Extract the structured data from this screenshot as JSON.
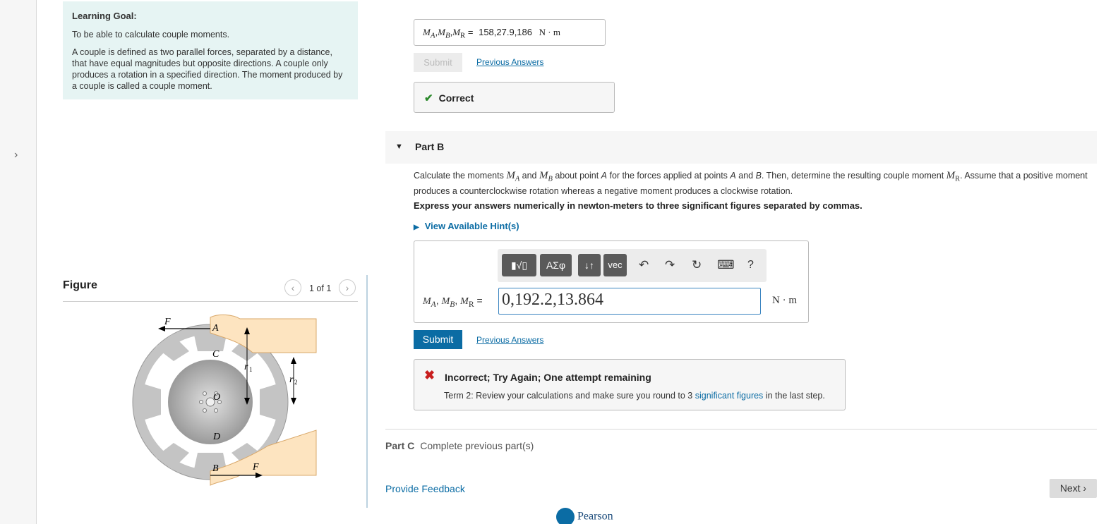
{
  "left": {
    "goal_title": "Learning Goal:",
    "goal_line1": "To be able to calculate couple moments.",
    "goal_line2": "A couple is defined as two parallel forces, separated by a distance, that have equal magnitudes but opposite directions. A couple only produces a rotation in a specified direction. The moment produced by a couple is called a couple moment.",
    "figure_title": "Figure",
    "pager_text": "1 of 1",
    "figure_labels": {
      "F_top": "F",
      "A": "A",
      "C": "C",
      "r1": "r",
      "r1_sub": "1",
      "r2": "r",
      "r2_sub": "2",
      "O": "O",
      "D": "D",
      "B": "B",
      "F_bottom": "F"
    }
  },
  "part_a": {
    "label_ma": "M",
    "sub_a": "A",
    "label_mb": "M",
    "sub_b": "B",
    "label_mr": "M",
    "sub_r": "R",
    "answer": "158,27.9,186",
    "unit": "N · m",
    "submit_label": "Submit",
    "previous_answers": "Previous Answers",
    "correct_label": "Correct"
  },
  "part_b": {
    "title": "Part B",
    "prompt_1": "Calculate the moments ",
    "prompt_2": " and ",
    "prompt_3": " about point ",
    "prompt_4": " for the forces applied at points ",
    "prompt_5": " and ",
    "prompt_6": ". Then, determine the resulting couple moment ",
    "prompt_7": ". Assume that a positive moment produces a counterclockwise rotation whereas a negative moment produces a clockwise rotation.",
    "pt_A": "A",
    "pt_B": "B",
    "express": "Express your answers numerically in newton-meters to three significant figures separated by commas.",
    "hint": "View Available Hint(s)",
    "toolbar": {
      "templates": "▮√▯",
      "greek": "ΑΣφ",
      "arrows": "↓↑",
      "vec": "vec",
      "undo": "↶",
      "redo": "↷",
      "reset": "↻",
      "keyboard": "⌨",
      "help": "?"
    },
    "input_value": "0,192.2,13.864",
    "unit": "N · m",
    "submit_label": "Submit",
    "previous_answers": "Previous Answers",
    "incorrect_title": "Incorrect; Try Again; One attempt remaining",
    "incorrect_msg_1": "Term 2: Review your calculations and make sure you round to 3 ",
    "incorrect_link": "significant figures",
    "incorrect_msg_2": " in the last step."
  },
  "part_c": {
    "label": "Part C",
    "text": "Complete previous part(s)"
  },
  "footer": {
    "feedback": "Provide Feedback",
    "next": "Next",
    "brand": "Pearson"
  },
  "colors": {
    "accent": "#0b6ca4",
    "goal_bg": "#e6f4f3",
    "correct": "#2d8a2d",
    "incorrect": "#c81e1e"
  },
  "icons": [
    "chevron-right-icon",
    "checkmark-icon",
    "caret-down-icon",
    "caret-right-icon",
    "x-icon",
    "undo-icon",
    "redo-icon",
    "reset-icon",
    "keyboard-icon",
    "help-icon"
  ]
}
